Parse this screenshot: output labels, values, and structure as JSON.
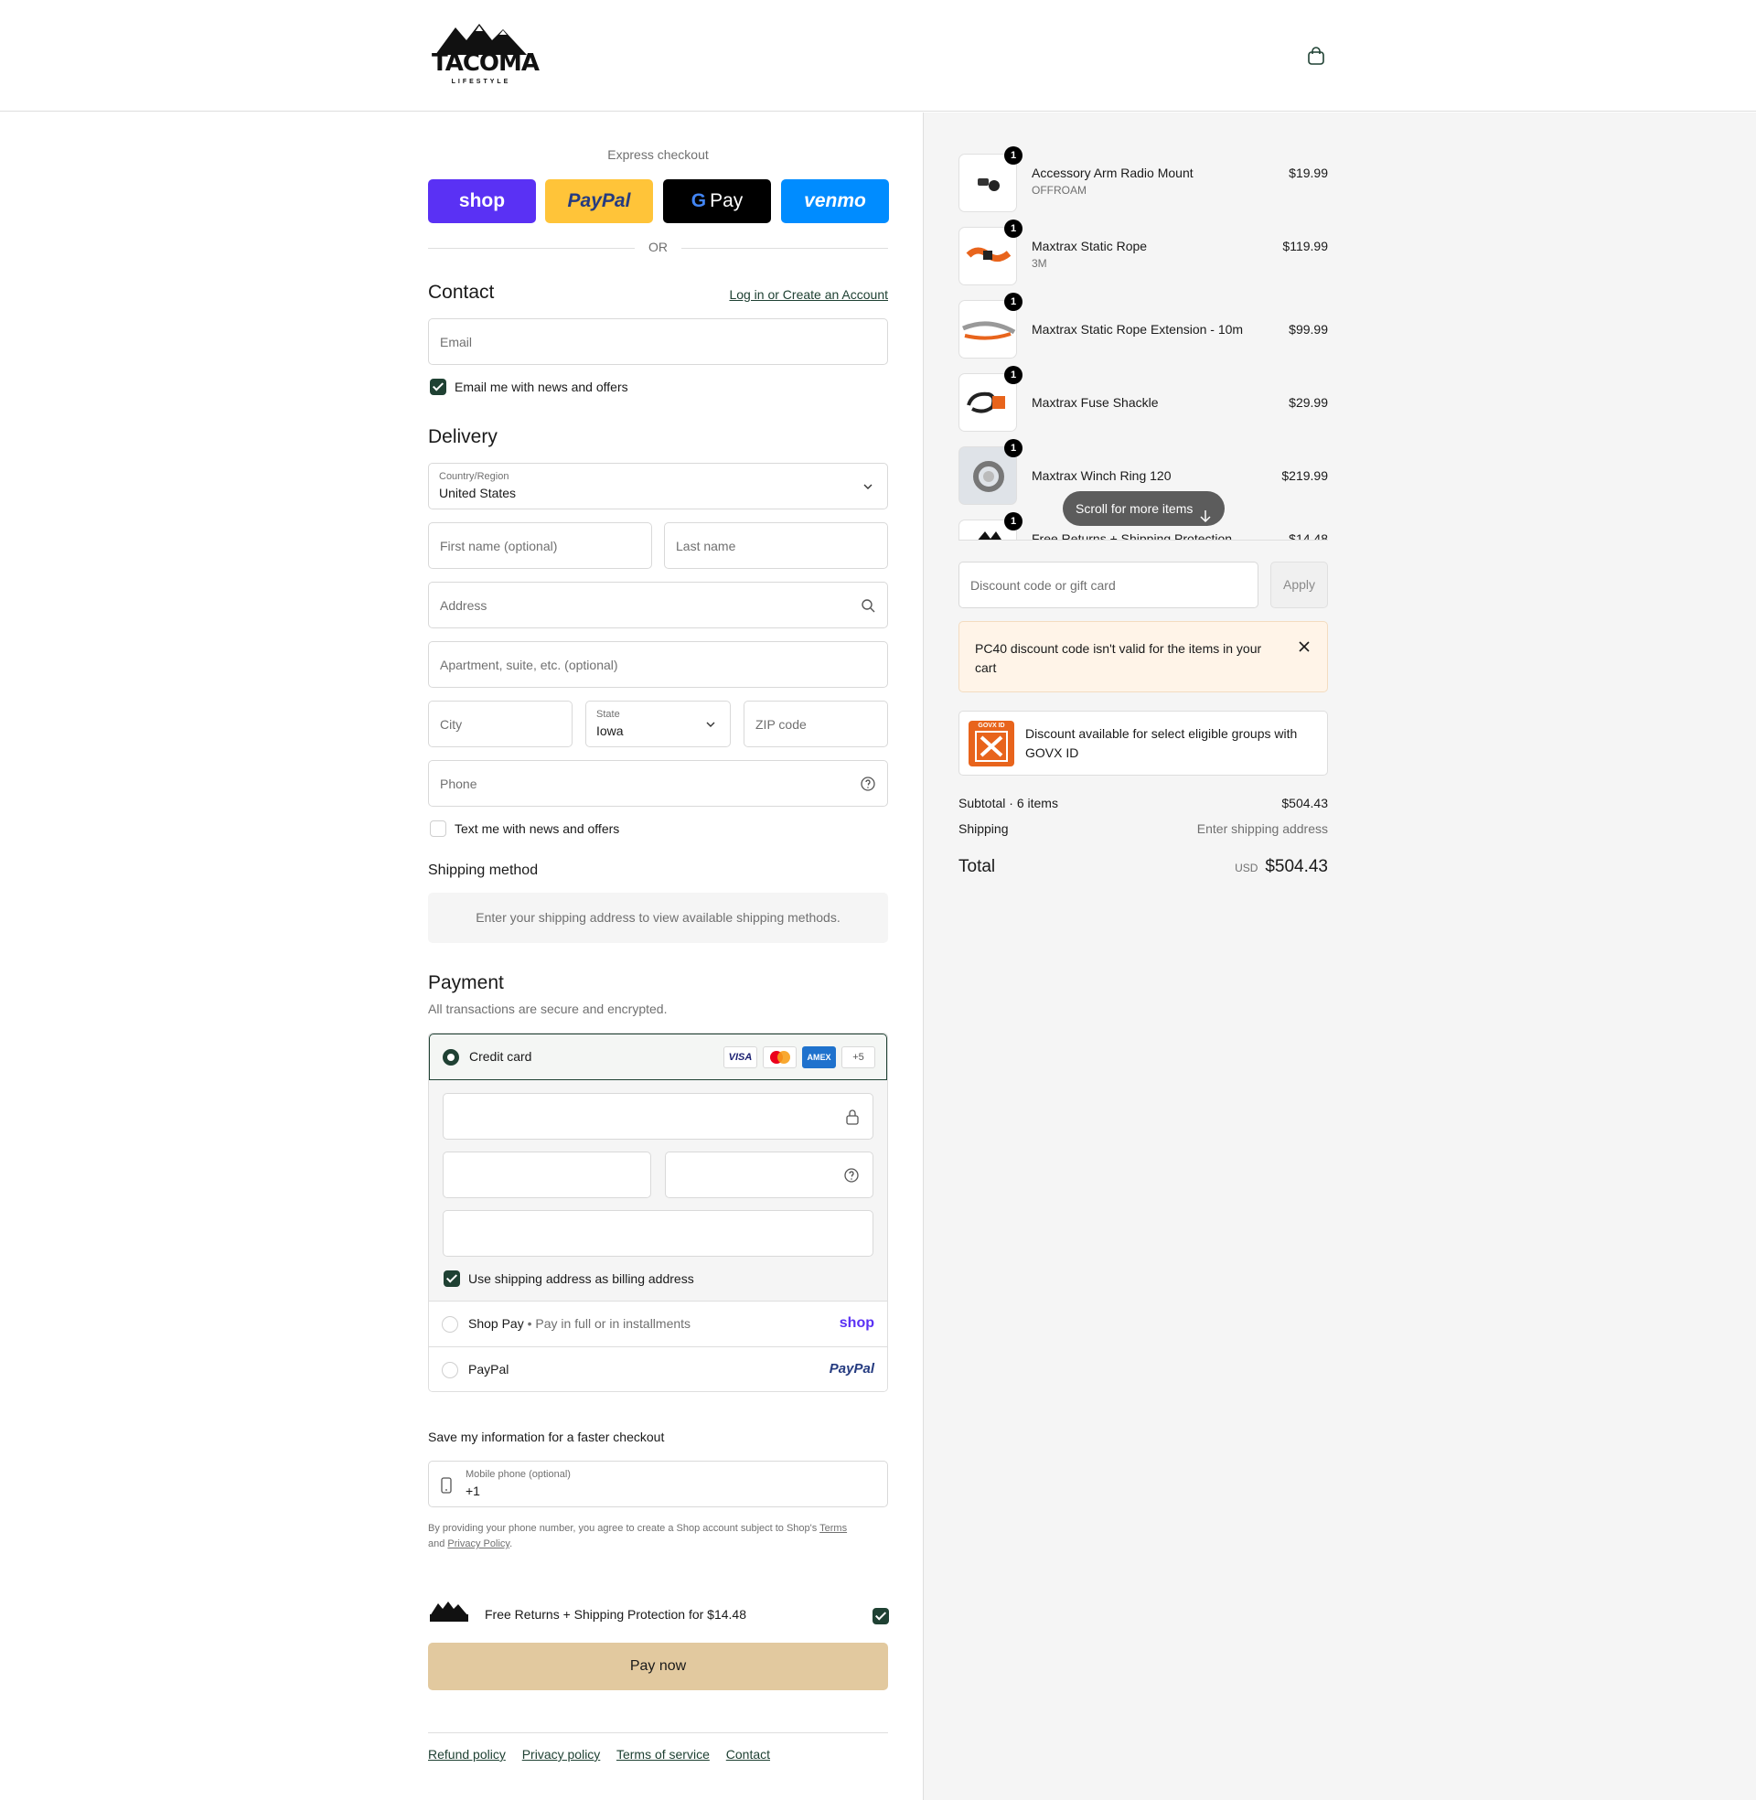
{
  "header": {
    "logo_text": "TACOMA",
    "logo_subtext": "LIFESTYLE",
    "cart_icon": "shopping-bag-icon"
  },
  "express": {
    "label": "Express checkout",
    "buttons": [
      {
        "label": "shop",
        "color": "#5a31f4"
      },
      {
        "label": "PayPal",
        "color": "#ffc439"
      },
      {
        "label": "Pay",
        "color": "#000000"
      },
      {
        "label": "venmo",
        "color": "#008cff"
      }
    ],
    "or_label": "OR"
  },
  "contact": {
    "title": "Contact",
    "login_link": "Log in or Create an Account",
    "email_placeholder": "Email",
    "news_label": "Email me with news and offers",
    "news_checked": true
  },
  "delivery": {
    "title": "Delivery",
    "country_label": "Country/Region",
    "country_value": "United States",
    "first_name_placeholder": "First name (optional)",
    "last_name_placeholder": "Last name",
    "address_placeholder": "Address",
    "apartment_placeholder": "Apartment, suite, etc. (optional)",
    "city_placeholder": "City",
    "state_label": "State",
    "state_value": "Iowa",
    "zip_placeholder": "ZIP code",
    "phone_placeholder": "Phone",
    "text_label": "Text me with news and offers",
    "text_checked": false
  },
  "shipping_method": {
    "title": "Shipping method",
    "message": "Enter your shipping address to view available shipping methods."
  },
  "payment": {
    "title": "Payment",
    "subtitle": "All transactions are secure and encrypted.",
    "credit_card_label": "Credit card",
    "card_logos": [
      "VISA",
      "AMEX",
      "+5"
    ],
    "billing_label": "Use shipping address as billing address",
    "billing_checked": true,
    "shop_pay_label": "Shop Pay",
    "shop_pay_sub": "Pay in full or in installments",
    "shop_pay_logo": "shop",
    "paypal_label": "PayPal",
    "paypal_logo": "PayPal"
  },
  "save_info": {
    "title": "Save my information for a faster checkout",
    "mobile_label": "Mobile phone (optional)",
    "mobile_value": "+1",
    "legal_prefix": "By providing your phone number, you agree to create a Shop account subject to Shop's",
    "legal_terms": "Terms",
    "legal_and": "and",
    "legal_privacy": "Privacy Policy",
    "legal_end": "."
  },
  "protection": {
    "label": "Free Returns + Shipping Protection for $14.48",
    "checked": true
  },
  "pay_now_label": "Pay now",
  "footer_links": [
    "Refund policy",
    "Privacy policy",
    "Terms of service",
    "Contact"
  ],
  "cart": {
    "items": [
      {
        "name": "Accessory Arm Radio Mount",
        "variant": "OFFROAM",
        "price": "$19.99",
        "qty": "1"
      },
      {
        "name": "Maxtrax Static Rope",
        "variant": "3M",
        "price": "$119.99",
        "qty": "1"
      },
      {
        "name": "Maxtrax Static Rope Extension - 10m",
        "variant": "",
        "price": "$99.99",
        "qty": "1"
      },
      {
        "name": "Maxtrax Fuse Shackle",
        "variant": "",
        "price": "$29.99",
        "qty": "1"
      },
      {
        "name": "Maxtrax Winch Ring 120",
        "variant": "",
        "price": "$219.99",
        "qty": "1"
      },
      {
        "name": "Free Returns + Shipping Protection",
        "variant": "",
        "price": "$14.48",
        "qty": "1"
      }
    ],
    "scroll_label": "Scroll for more items",
    "discount_placeholder": "Discount code or gift card",
    "apply_label": "Apply",
    "warning": "PC40 discount code isn't valid for the items in your cart",
    "govx_text": "Discount available for select eligible groups with GOVX ID",
    "govx_logo": "GOVX ID",
    "subtotal_label": "Subtotal · 6 items",
    "subtotal_value": "$504.43",
    "shipping_label": "Shipping",
    "shipping_value": "Enter shipping address",
    "total_label": "Total",
    "total_currency": "USD",
    "total_value": "$504.43"
  },
  "colors": {
    "accent": "#1f4133",
    "pay_button": "#e2c99f",
    "warning_bg": "#fff4e8"
  }
}
